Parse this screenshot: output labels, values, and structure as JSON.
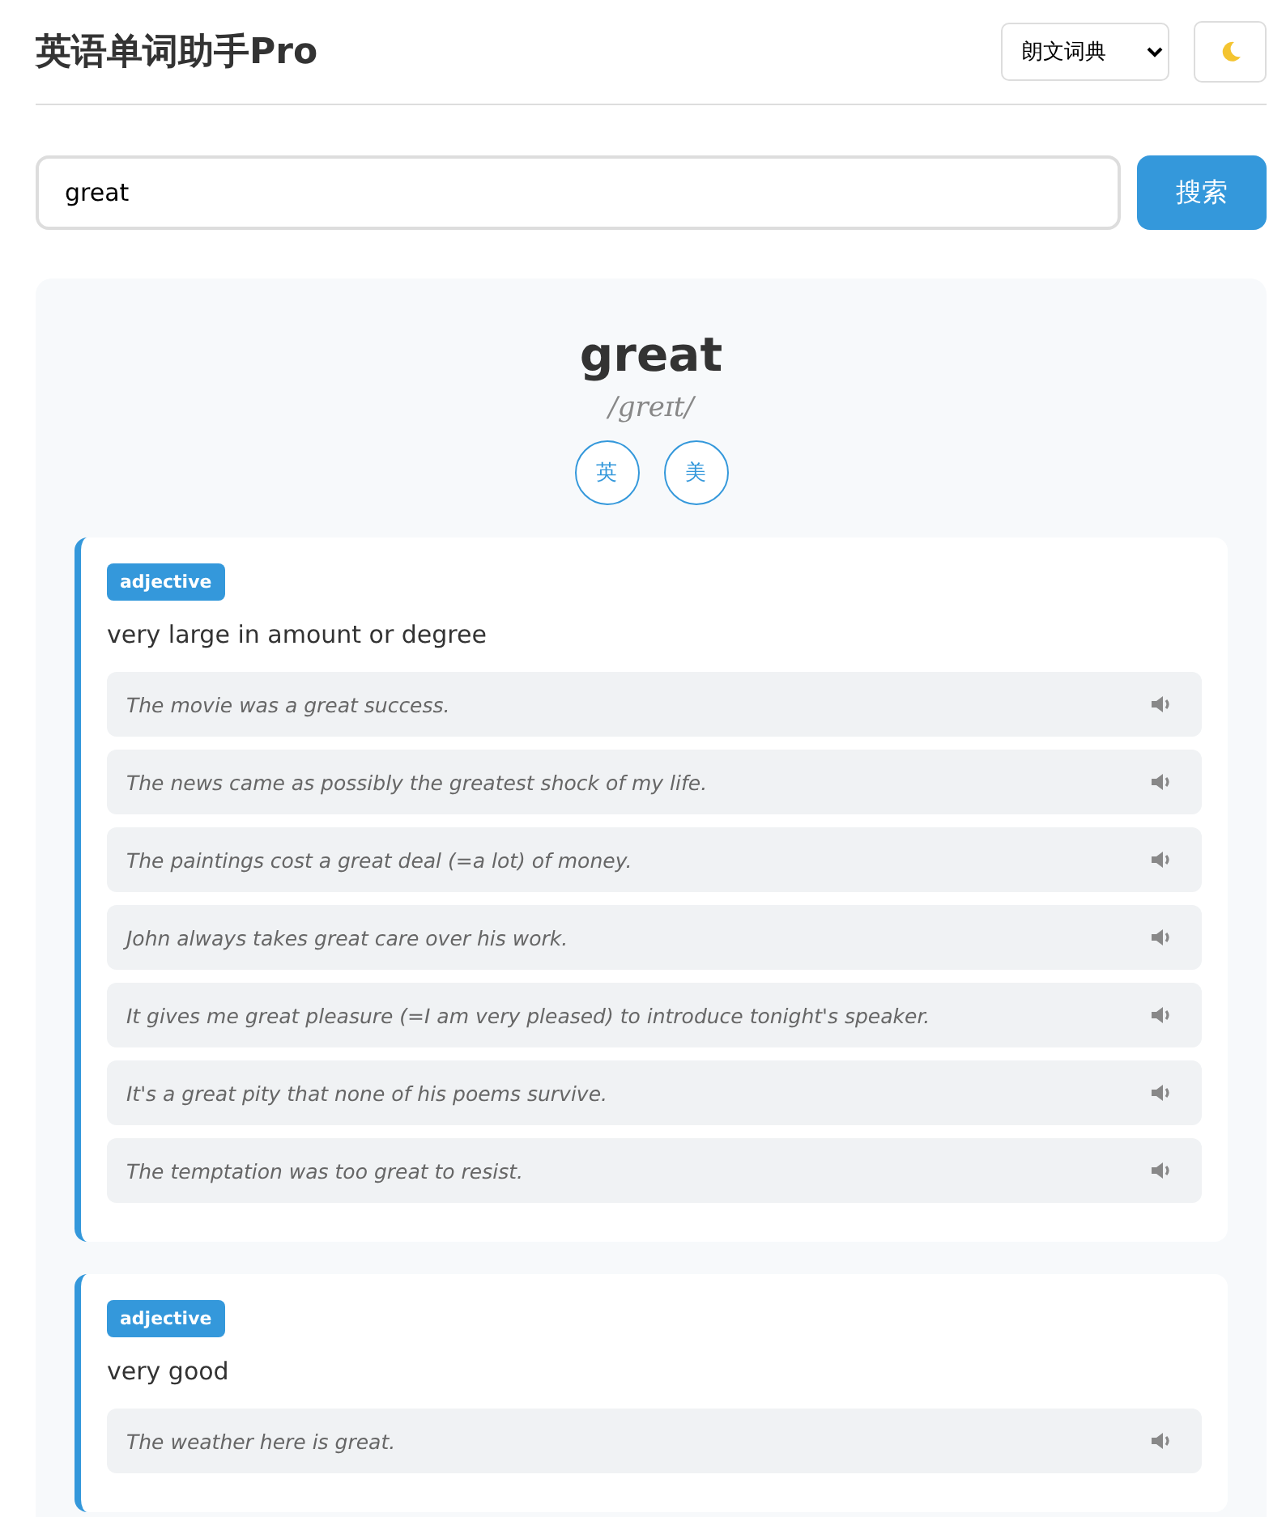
{
  "header": {
    "title": "英语单词助手Pro",
    "dictionary": "朗文词典"
  },
  "search": {
    "value": "great",
    "button": "搜索"
  },
  "word": {
    "headword": "great",
    "phonetic": "/greɪt/",
    "pronunciations": [
      "英",
      "美"
    ]
  },
  "senses": [
    {
      "part_of_speech": "adjective",
      "definition": "very large in amount or degree",
      "examples": [
        "The movie was a great success.",
        "The news came as possibly the greatest shock of my life.",
        "The paintings cost a great deal (=a lot) of money.",
        "John always takes great care over his work.",
        "It gives me great pleasure (=I am very pleased) to introduce tonight's speaker.",
        "It's a great pity that none of his poems survive.",
        "The temptation was too great to resist."
      ]
    },
    {
      "part_of_speech": "adjective",
      "definition": "very good",
      "examples": [
        "The weather here is great."
      ]
    }
  ]
}
